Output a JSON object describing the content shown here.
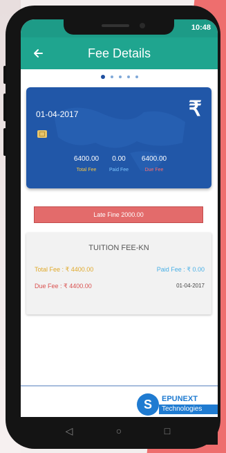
{
  "status": {
    "time": "10:48"
  },
  "app_bar": {
    "back_icon": "arrow-left-icon",
    "title": "Fee Details"
  },
  "pager": {
    "count": 5,
    "active_index": 0
  },
  "summary_card": {
    "date": "01-04-2017",
    "currency_symbol": "₹",
    "total_fee": {
      "value": "6400.00",
      "label": "Total Fee",
      "color": "#f5c542"
    },
    "paid_fee": {
      "value": "0.00",
      "label": "Paid Fee",
      "color": "#7fc8ff"
    },
    "due_fee": {
      "value": "6400.00",
      "label": "Due Fee",
      "color": "#ff6b6b"
    }
  },
  "late_fee": {
    "text": "Late Fine 2000.00",
    "color": "#e36b6b"
  },
  "fee_item": {
    "name": "TUITION FEE-KN",
    "total": "Total Fee : ₹ 4400.00",
    "paid": "Paid Fee : ₹ 0.00",
    "due": "Due Fee : ₹ 4400.00",
    "date": "01-04-2017"
  },
  "watermark": {
    "line1": "EPUNEXT",
    "line2": "Technologies",
    "badge": "S"
  },
  "nav": {
    "back": "◁",
    "home": "○",
    "recents": "□"
  },
  "colors": {
    "primary": "#1fa58f",
    "card": "#2157a8"
  }
}
